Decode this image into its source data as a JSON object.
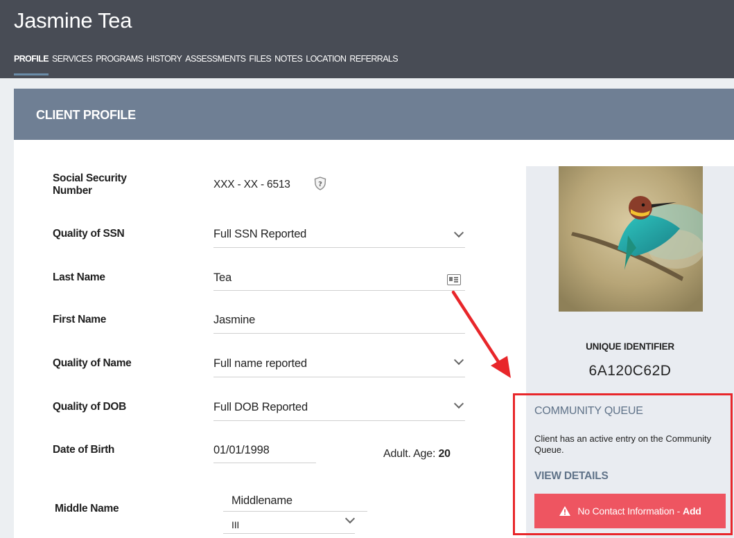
{
  "header": {
    "client_name": "Jasmine Tea",
    "tabs": [
      {
        "label": "PROFILE",
        "active": true
      },
      {
        "label": "SERVICES",
        "active": false
      },
      {
        "label": "PROGRAMS",
        "active": false
      },
      {
        "label": "HISTORY",
        "active": false
      },
      {
        "label": "ASSESSMENTS",
        "active": false
      },
      {
        "label": "FILES",
        "active": false
      },
      {
        "label": "NOTES",
        "active": false
      },
      {
        "label": "LOCATION",
        "active": false
      },
      {
        "label": "REFERRALS",
        "active": false
      }
    ]
  },
  "panel": {
    "title": "CLIENT PROFILE"
  },
  "form": {
    "ssn": {
      "label": "Social Security Number",
      "value": "XXX - XX - 6513",
      "icon": "shield-question-icon"
    },
    "quality_ssn": {
      "label": "Quality of SSN",
      "value": "Full SSN Reported"
    },
    "last_name": {
      "label": "Last Name",
      "value": "Tea",
      "icon": "id-card-icon"
    },
    "first_name": {
      "label": "First Name",
      "value": "Jasmine"
    },
    "quality_name": {
      "label": "Quality of Name",
      "value": "Full name reported"
    },
    "quality_dob": {
      "label": "Quality of DOB",
      "value": "Full DOB Reported"
    },
    "dob": {
      "label": "Date of Birth",
      "value": "01/01/1998",
      "age_prefix": "Adult. Age:",
      "age": "20"
    },
    "middle_name": {
      "label": "Middle Name",
      "value": "Middlename",
      "suffix": "III"
    }
  },
  "profile": {
    "uid_label": "UNIQUE IDENTIFIER",
    "uid_value": "6A120C62D"
  },
  "community_queue": {
    "title": "COMMUNITY QUEUE",
    "text": "Client has an active entry on the Community Queue.",
    "view_details": "VIEW DETAILS",
    "alert_text": "No Contact Information -",
    "alert_action": "Add",
    "alert_icon": "warning-triangle-icon"
  },
  "colors": {
    "header_bg": "#484c55",
    "panel_header_bg": "#6f7f94",
    "accent_text": "#5f7288",
    "alert_bg": "#ee5561",
    "highlight_border": "#e8262a"
  }
}
